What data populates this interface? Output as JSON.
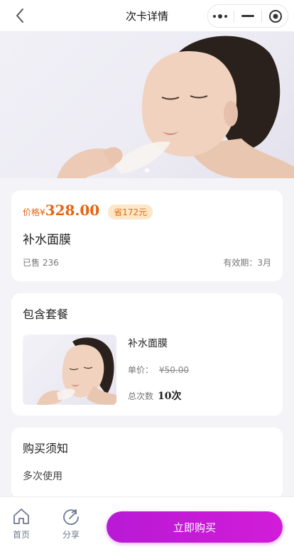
{
  "header": {
    "title": "次卡详情",
    "back_icon": "chevron-left-icon",
    "capsule": [
      "more-icon",
      "minimize-icon",
      "target-icon"
    ]
  },
  "banner": {
    "image": "woman-applying-face-mask-photo"
  },
  "price_card": {
    "price_label": "价格",
    "currency": "¥",
    "price": "328.00",
    "save_badge": "省172元",
    "product_name": "补水面膜",
    "sold": "已售 236",
    "validity": "有效期：3月"
  },
  "package": {
    "title": "包含套餐",
    "item_name": "补水面膜",
    "unit_price_label": "单价：",
    "unit_price": "¥50.00",
    "count_label": "总次数",
    "count": "10次"
  },
  "notice": {
    "title": "购买须知",
    "text": "多次使用"
  },
  "bottom_bar": {
    "home_label": "首页",
    "share_label": "分享",
    "buy_label": "立即购买"
  },
  "colors": {
    "price": "#e8620d",
    "buy_button": "#c11bd7",
    "badge_bg": "#fde7c8"
  }
}
